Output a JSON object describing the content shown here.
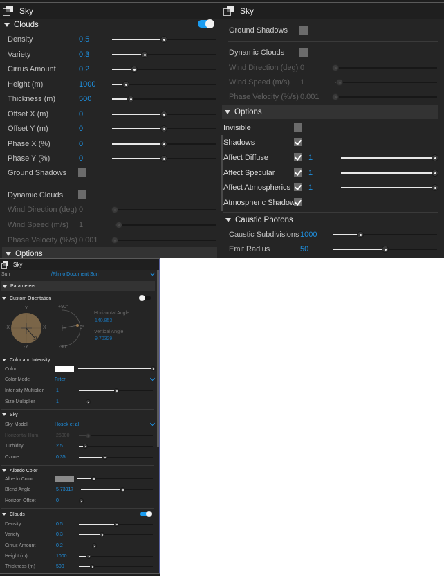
{
  "colors": {
    "accent": "#1e90e0",
    "panel_bg": "#252525",
    "toggle_on": "#1a9cf0",
    "orientation_disc": "#7a6548"
  },
  "panel_top_left": {
    "title": "Sky",
    "clouds": {
      "header": "Clouds",
      "enabled": true,
      "rows": [
        {
          "label": "Density",
          "value": "0.5",
          "fraction": 0.5
        },
        {
          "label": "Variety",
          "value": "0.3",
          "fraction": 0.31
        },
        {
          "label": "Cirrus Amount",
          "value": "0.2",
          "fraction": 0.21
        },
        {
          "label": "Height (m)",
          "value": "1000",
          "fraction": 0.13
        },
        {
          "label": "Thickness (m)",
          "value": "500",
          "fraction": 0.18
        },
        {
          "label": "Offset X (m)",
          "value": "0",
          "fraction": 0.5
        },
        {
          "label": "Offset Y (m)",
          "value": "0",
          "fraction": 0.5
        },
        {
          "label": "Phase X (%)",
          "value": "0",
          "fraction": 0.5
        },
        {
          "label": "Phase Y (%)",
          "value": "0",
          "fraction": 0.5
        }
      ],
      "ground_shadows": {
        "label": "Ground Shadows",
        "checked": false
      },
      "dynamic_clouds": {
        "label": "Dynamic Clouds",
        "checked": false
      },
      "disabled_rows": [
        {
          "label": "Wind Direction (deg)",
          "value": "0",
          "fraction": 0.0
        },
        {
          "label": "Wind Speed (m/s)",
          "value": "1",
          "fraction": 0.04
        },
        {
          "label": "Phase Velocity (%/s)",
          "value": "0.001",
          "fraction": 0.0
        }
      ]
    },
    "options_header": "Options"
  },
  "panel_top_right": {
    "title": "Sky",
    "ground_shadows": {
      "label": "Ground Shadows",
      "checked": false
    },
    "dynamic_clouds": {
      "label": "Dynamic Clouds",
      "checked": false
    },
    "disabled_rows": [
      {
        "label": "Wind Direction (deg)",
        "value": "0",
        "fraction": 0.0
      },
      {
        "label": "Wind Speed (m/s)",
        "value": "1",
        "fraction": 0.04
      },
      {
        "label": "Phase Velocity (%/s)",
        "value": "0.001",
        "fraction": 0.0
      }
    ],
    "options": {
      "header": "Options",
      "invisible": {
        "label": "Invisible",
        "checked": false
      },
      "shadows": {
        "label": "Shadows",
        "checked": true
      },
      "affect_rows": [
        {
          "label": "Affect Diffuse",
          "checked": true,
          "value": "1",
          "fraction": 1.0
        },
        {
          "label": "Affect Specular",
          "checked": true,
          "value": "1",
          "fraction": 1.0
        },
        {
          "label": "Affect Atmospherics",
          "checked": true,
          "value": "1",
          "fraction": 1.0
        }
      ],
      "atmospheric_shadows": {
        "label": "Atmospheric Shadows",
        "checked": true
      }
    },
    "caustic": {
      "header": "Caustic Photons",
      "rows": [
        {
          "label": "Caustic Subdivisions",
          "value": "1000",
          "fraction": 0.26
        },
        {
          "label": "Emit Radius",
          "value": "50",
          "fraction": 0.5
        }
      ]
    }
  },
  "panel_bottom_left": {
    "title": "Sky",
    "sun": {
      "label": "Sun",
      "value": "/Rhino Document Sun"
    },
    "parameters_header": "Parameters",
    "custom_orientation": {
      "header": "Custom Orientation",
      "enabled": false,
      "compass_labels": {
        "top": "Y",
        "bottom": "-Y",
        "left": "-X",
        "right": "X"
      },
      "arc_labels": {
        "top": "+90°",
        "middle": "0°",
        "bottom": "-90°"
      },
      "horizontal_angle_label": "Horizontal Angle",
      "horizontal_angle": "140.853",
      "vertical_angle_label": "Vertical Angle",
      "vertical_angle": "9.70329"
    },
    "color_intensity": {
      "header": "Color and Intensity",
      "color_label": "Color",
      "color_value": "#ffffff",
      "color_fraction": 1.0,
      "color_mode_label": "Color Mode",
      "color_mode": "Filter",
      "rows": [
        {
          "label": "Intensity Multiplier",
          "value": "1",
          "fraction": 0.5
        },
        {
          "label": "Size Multiplier",
          "value": "1",
          "fraction": 0.12
        }
      ]
    },
    "sky": {
      "header": "Sky",
      "sky_model_label": "Sky Model",
      "sky_model": "Hosek et al",
      "horizontal_illum": {
        "label": "Horizontal Illum.",
        "value": "25000",
        "fraction": 0.12
      },
      "rows": [
        {
          "label": "Turbidity",
          "value": "2.5",
          "fraction": 0.08
        },
        {
          "label": "Ozone",
          "value": "0.35",
          "fraction": 0.35
        }
      ]
    },
    "albedo": {
      "header": "Albedo Color",
      "albedo_color_label": "Albedo Color",
      "albedo_color_value": "#8a8a8a",
      "albedo_fraction": 0.21,
      "rows": [
        {
          "label": "Blend Angle",
          "value": "5.73917",
          "fraction": 0.58
        },
        {
          "label": "Horizon Offset",
          "value": "0",
          "fraction": 0.0
        }
      ]
    },
    "clouds": {
      "header": "Clouds",
      "enabled": true,
      "rows": [
        {
          "label": "Density",
          "value": "0.5",
          "fraction": 0.5
        },
        {
          "label": "Variety",
          "value": "0.3",
          "fraction": 0.31
        },
        {
          "label": "Cirrus Amount",
          "value": "0.2",
          "fraction": 0.21
        },
        {
          "label": "Height (m)",
          "value": "1000",
          "fraction": 0.13
        },
        {
          "label": "Thickness (m)",
          "value": "500",
          "fraction": 0.18
        }
      ]
    }
  }
}
